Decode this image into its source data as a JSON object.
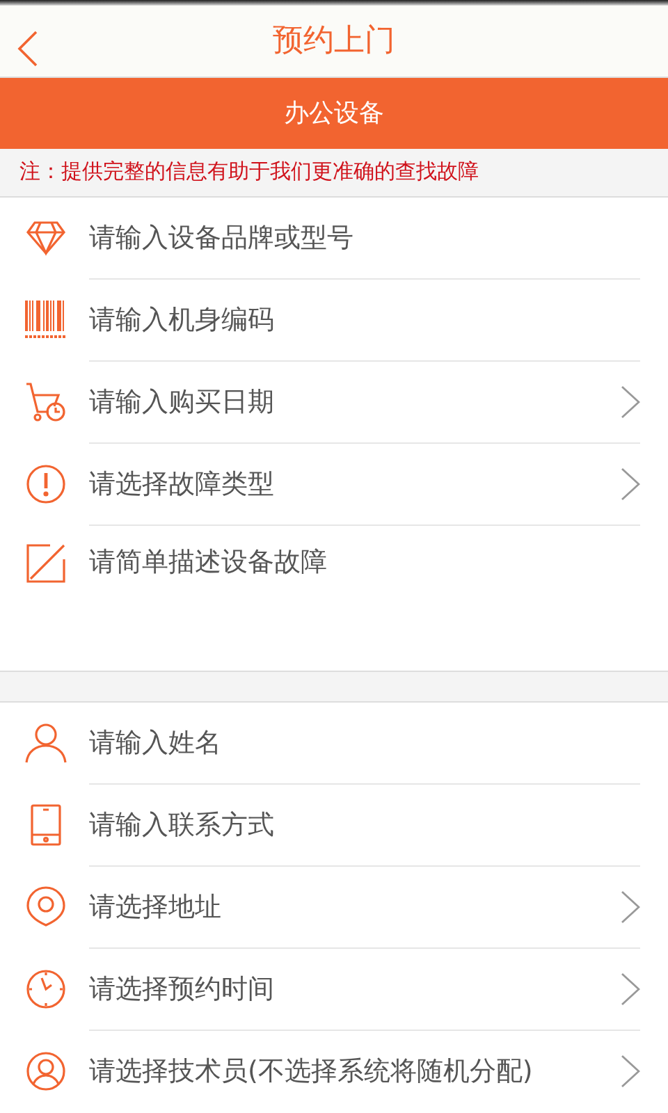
{
  "header": {
    "title": "预约上门"
  },
  "category_banner": {
    "label": "办公设备"
  },
  "notice": "注：提供完整的信息有助于我们更准确的查找故障",
  "device_section": [
    {
      "kind": "input",
      "placeholder": "请输入设备品牌或型号"
    },
    {
      "kind": "input",
      "placeholder": "请输入机身编码"
    },
    {
      "kind": "select",
      "label": "请输入购买日期"
    },
    {
      "kind": "select",
      "label": "请选择故障类型"
    },
    {
      "kind": "textarea",
      "placeholder": "请简单描述设备故障"
    }
  ],
  "contact_section": [
    {
      "kind": "input",
      "placeholder": "请输入姓名"
    },
    {
      "kind": "input",
      "placeholder": "请输入联系方式"
    },
    {
      "kind": "select",
      "label": "请选择地址"
    },
    {
      "kind": "select",
      "label": "请选择预约时间"
    },
    {
      "kind": "select",
      "label": "请选择技术员(不选择系统将随机分配)"
    }
  ]
}
